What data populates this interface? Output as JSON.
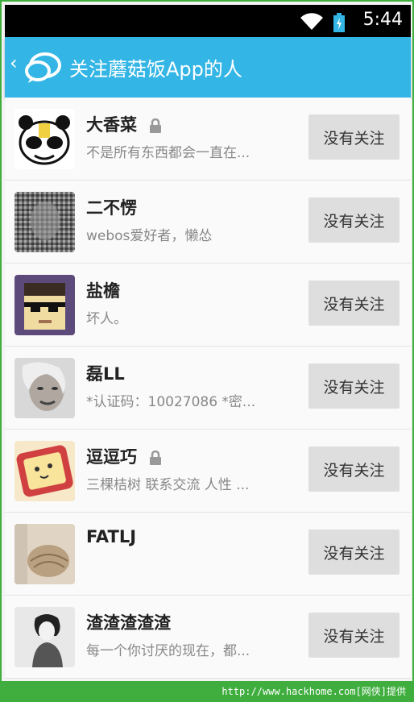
{
  "status_bar": {
    "time": "5:44"
  },
  "action_bar": {
    "back_glyph": "‹",
    "title": "关注蘑菇饭App的人"
  },
  "follow_label": "没有关注",
  "users": [
    {
      "name": "大香菜",
      "locked": true,
      "desc": "不是所有东西都会一直在..."
    },
    {
      "name": "二不愣",
      "locked": false,
      "desc": "webos爱好者，懒怂"
    },
    {
      "name": "盐檐",
      "locked": false,
      "desc": "坏人。"
    },
    {
      "name": "磊LL",
      "locked": false,
      "desc": "*认证码：10027086 *密..."
    },
    {
      "name": "逗逗巧",
      "locked": true,
      "desc": "三棵桔树 联系交流 人性 ..."
    },
    {
      "name": "FATLJ",
      "locked": false,
      "desc": ""
    },
    {
      "name": "渣渣渣渣渣",
      "locked": false,
      "desc": "每一个你讨厌的现在，都..."
    }
  ],
  "watermark": "http://www.hackhome.com[网侠]提供"
}
